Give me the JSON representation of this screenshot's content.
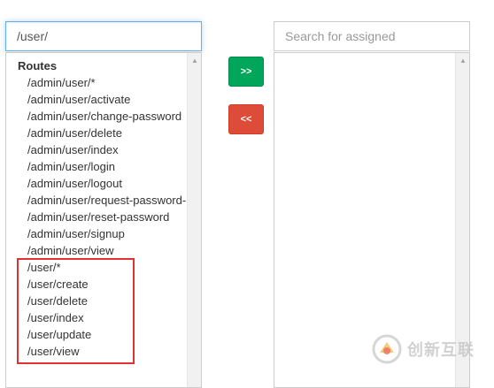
{
  "available": {
    "search_value": "/user/",
    "group_label": "Routes",
    "routes": [
      "/admin/user/*",
      "/admin/user/activate",
      "/admin/user/change-password",
      "/admin/user/delete",
      "/admin/user/index",
      "/admin/user/login",
      "/admin/user/logout",
      "/admin/user/request-password-reset",
      "/admin/user/reset-password",
      "/admin/user/signup",
      "/admin/user/view",
      "/user/*",
      "/user/create",
      "/user/delete",
      "/user/index",
      "/user/update",
      "/user/view"
    ]
  },
  "buttons": {
    "assign_label": ">>",
    "remove_label": "<<",
    "assign_color": "#00a65a",
    "remove_color": "#dd4b39"
  },
  "assigned": {
    "search_placeholder": "Search for assigned"
  },
  "highlight": {
    "color": "#e0322f"
  },
  "watermark": {
    "text": "创新互联",
    "logo_icon": "brand-logo-icon"
  }
}
